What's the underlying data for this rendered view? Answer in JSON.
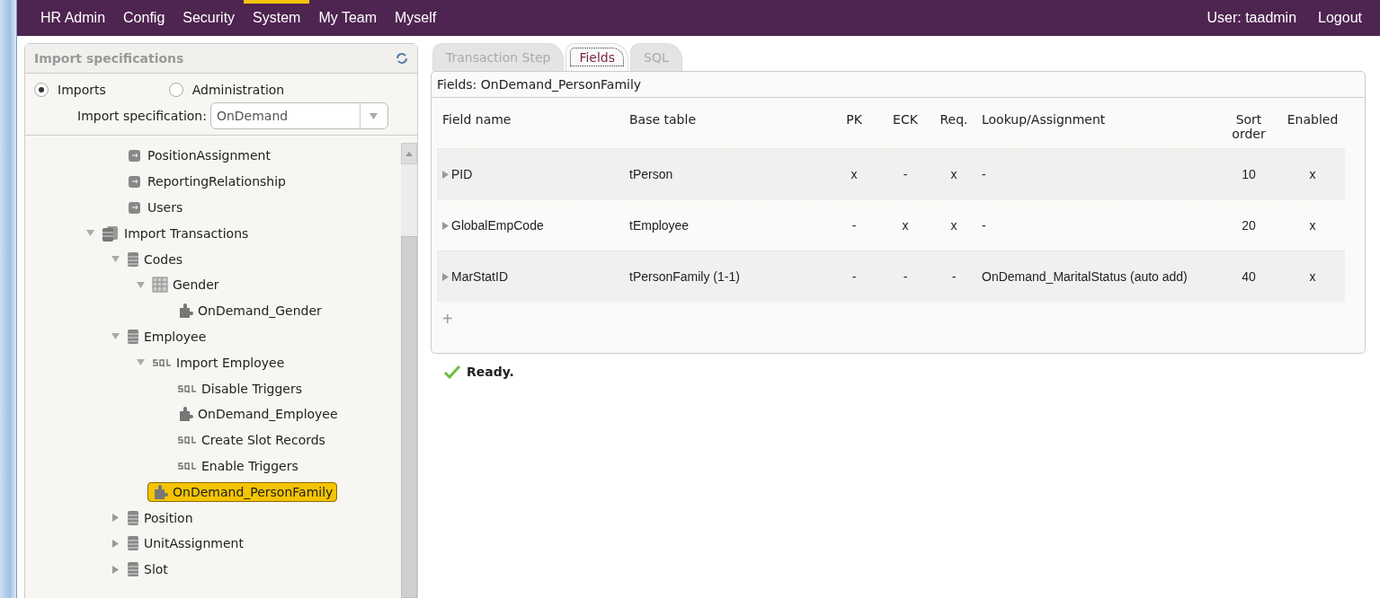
{
  "menu": {
    "items": [
      {
        "label": "HR Admin",
        "selected": false
      },
      {
        "label": "Config",
        "selected": false
      },
      {
        "label": "Security",
        "selected": false
      },
      {
        "label": "System",
        "selected": true
      },
      {
        "label": "My Team",
        "selected": false
      },
      {
        "label": "Myself",
        "selected": false
      }
    ],
    "user": "User: taadmin",
    "logout": "Logout"
  },
  "sidebar": {
    "title": "Import specifications",
    "modes": [
      {
        "label": "Imports",
        "selected": true
      },
      {
        "label": "Administration",
        "selected": false
      }
    ],
    "spec_label": "Import specification:",
    "spec_value": "OnDemand",
    "tree": {
      "continued_items": [
        {
          "label": "PositionAssignment",
          "kind": "step",
          "selected": false
        },
        {
          "label": "ReportingRelationship",
          "kind": "step",
          "selected": false
        },
        {
          "label": "Users",
          "kind": "step",
          "selected": false
        }
      ],
      "items": [
        {
          "label": "Import Transactions",
          "kind": "database",
          "expanded": true,
          "selected": false,
          "children": [
            {
              "label": "Codes",
              "kind": "table",
              "expanded": true,
              "selected": false,
              "children": [
                {
                  "label": "Gender",
                  "kind": "grid",
                  "expanded": true,
                  "selected": false,
                  "children": [
                    {
                      "label": "OnDemand_Gender",
                      "kind": "mapping",
                      "selected": false
                    }
                  ]
                }
              ]
            },
            {
              "label": "Employee",
              "kind": "table",
              "expanded": true,
              "selected": false,
              "children": [
                {
                  "label": "Import Employee",
                  "kind": "sql",
                  "expanded": true,
                  "selected": false,
                  "children": [
                    {
                      "label": "Disable Triggers",
                      "kind": "sql",
                      "selected": false
                    },
                    {
                      "label": "OnDemand_Employee",
                      "kind": "mapping",
                      "selected": false
                    },
                    {
                      "label": "Create Slot Records",
                      "kind": "sql",
                      "selected": false
                    },
                    {
                      "label": "Enable Triggers",
                      "kind": "sql",
                      "selected": false
                    }
                  ]
                },
                {
                  "label": "OnDemand_PersonFamily",
                  "kind": "mapping",
                  "selected": true
                }
              ]
            },
            {
              "label": "Position",
              "kind": "table",
              "expanded": false,
              "selected": false
            },
            {
              "label": "UnitAssignment",
              "kind": "table",
              "expanded": false,
              "selected": false
            },
            {
              "label": "Slot",
              "kind": "table",
              "expanded": false,
              "selected": false
            }
          ]
        }
      ]
    }
  },
  "tabs": [
    {
      "label": "Transaction Step",
      "selected": false
    },
    {
      "label": "Fields",
      "selected": true
    },
    {
      "label": "SQL",
      "selected": false
    }
  ],
  "panel": {
    "title": "Fields: OnDemand_PersonFamily",
    "table": {
      "columns": [
        "Field name",
        "Base table",
        "PK",
        "ECK",
        "Req.",
        "Lookup/Assignment",
        "Sort order",
        "Enabled"
      ],
      "rows": [
        {
          "cells": [
            "PID",
            "tPerson",
            "x",
            "-",
            "x",
            "-",
            "10",
            "x"
          ]
        },
        {
          "cells": [
            "GlobalEmpCode",
            "tEmployee",
            "-",
            "x",
            "x",
            "-",
            "20",
            "x"
          ]
        },
        {
          "cells": [
            "MarStatID",
            "tPersonFamily (1-1)",
            "-",
            "-",
            "-",
            "OnDemand_MaritalStatus (auto add)",
            "40",
            "x"
          ]
        }
      ],
      "add": "+"
    }
  },
  "status": "Ready."
}
